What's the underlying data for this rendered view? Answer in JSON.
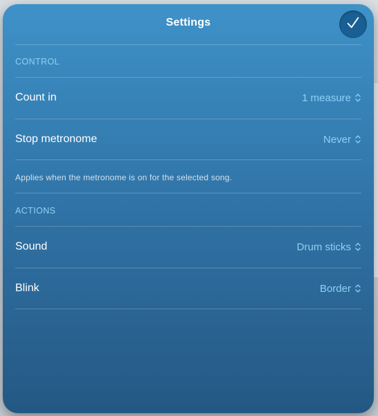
{
  "header": {
    "title": "Settings",
    "done_icon": "checkmark-icon"
  },
  "colors": {
    "panel_top": "#3f92c8",
    "panel_bottom": "#245883",
    "accent": "#8fd0f5",
    "done_button": "#1a5f93"
  },
  "control": {
    "header": "CONTROL",
    "count_in": {
      "label": "Count in",
      "value": "1 measure"
    },
    "stop_metronome": {
      "label": "Stop metronome",
      "value": "Never"
    },
    "footnote": "Applies when the metronome is on for the selected song."
  },
  "actions": {
    "header": "ACTIONS",
    "sound": {
      "label": "Sound",
      "value": "Drum sticks"
    },
    "blink": {
      "label": "Blink",
      "value": "Border"
    }
  }
}
